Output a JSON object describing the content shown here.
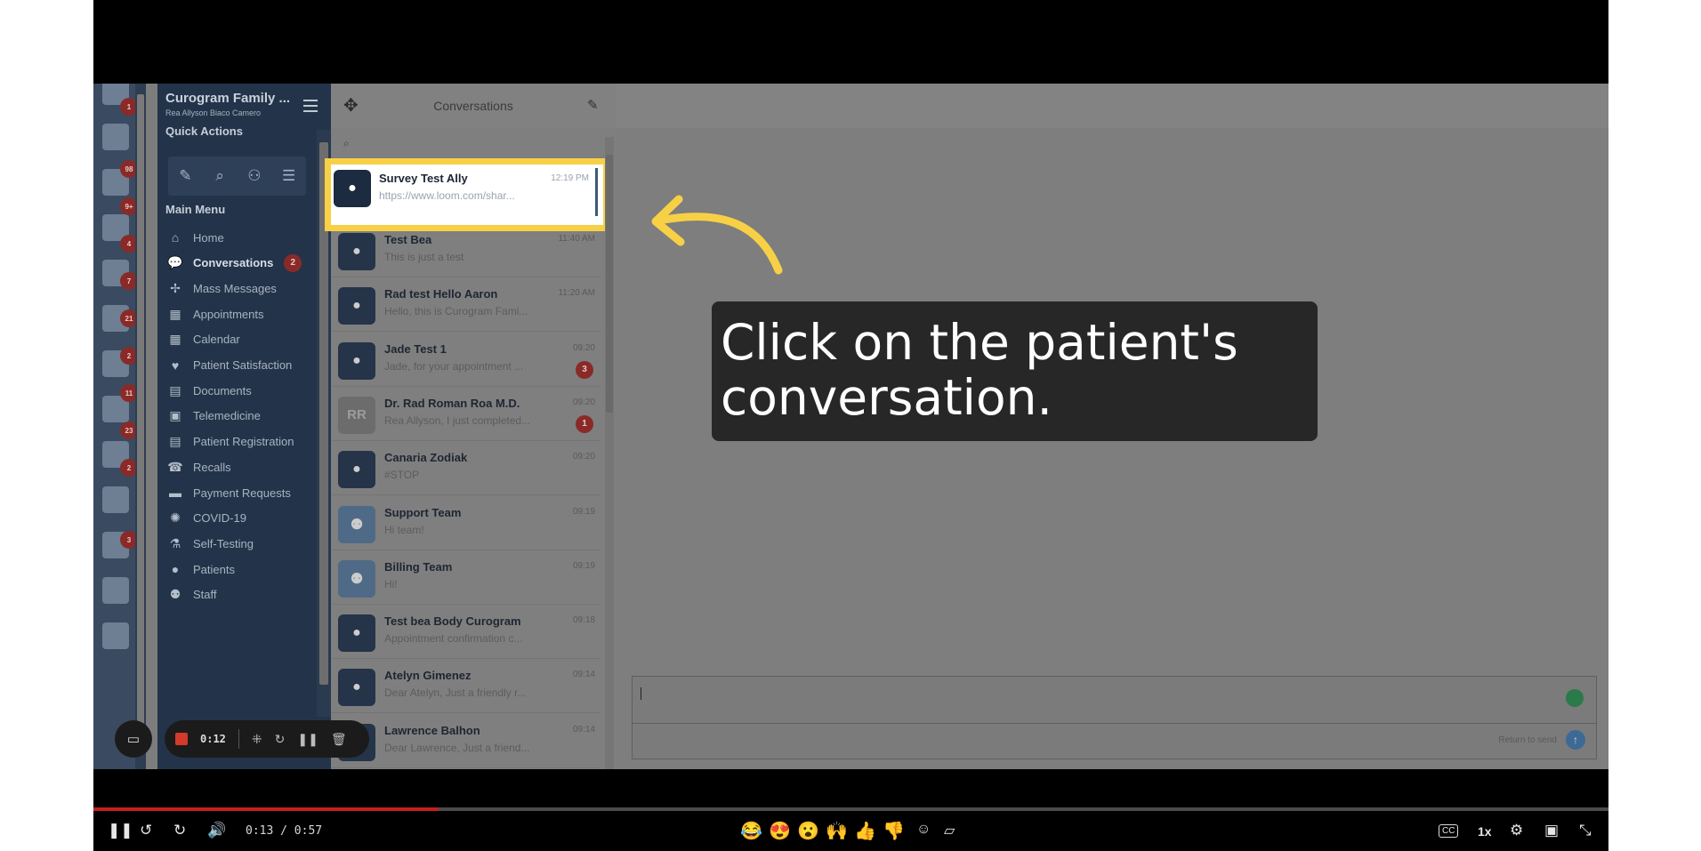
{
  "sidebar": {
    "title": "Curogram Family ...",
    "subtitle": "Rea Allyson Biaco Camero",
    "quick_actions_title": "Quick Actions",
    "main_menu_title": "Main Menu",
    "menu": [
      {
        "label": "Home",
        "icon": "home-icon"
      },
      {
        "label": "Conversations",
        "icon": "chat-icon",
        "badge": "2"
      },
      {
        "label": "Mass Messages",
        "icon": "broadcast-icon"
      },
      {
        "label": "Appointments",
        "icon": "appointments-icon"
      },
      {
        "label": "Calendar",
        "icon": "calendar-icon"
      },
      {
        "label": "Patient Satisfaction",
        "icon": "heart-icon"
      },
      {
        "label": "Documents",
        "icon": "documents-icon"
      },
      {
        "label": "Telemedicine",
        "icon": "telemedicine-icon"
      },
      {
        "label": "Patient Registration",
        "icon": "registration-icon"
      },
      {
        "label": "Recalls",
        "icon": "phone-recall-icon"
      },
      {
        "label": "Payment Requests",
        "icon": "card-icon"
      },
      {
        "label": "COVID-19",
        "icon": "virus-icon"
      },
      {
        "label": "Self-Testing",
        "icon": "flask-icon"
      },
      {
        "label": "Patients",
        "icon": "person-icon"
      },
      {
        "label": "Staff",
        "icon": "group-icon"
      }
    ]
  },
  "app_strip": {
    "badges": [
      "1",
      "98",
      "9+",
      "4",
      "7",
      "21",
      "2",
      "11",
      "23",
      "2",
      "3"
    ]
  },
  "conversations": {
    "title": "Conversations",
    "items": [
      {
        "name": "Survey Test Ally",
        "preview": "https://www.loom.com/shar...",
        "time": "12:19 PM",
        "avatar": "person"
      },
      {
        "name": "Test Bea",
        "preview": "This is just a test",
        "time": "11:40 AM",
        "avatar": "person"
      },
      {
        "name": "Rad test Hello Aaron",
        "preview": "Hello, this is Curogram Fami...",
        "time": "11:20 AM",
        "avatar": "person"
      },
      {
        "name": "Jade Test 1",
        "preview": "Jade, for your appointment ...",
        "time": "09:20",
        "avatar": "person",
        "unread": "3"
      },
      {
        "name": "Dr. Rad Roman Roa M.D.",
        "preview": "Rea Allyson, I just completed...",
        "time": "09:20",
        "avatar": "RR",
        "unread": "1"
      },
      {
        "name": "Canaria Zodiak",
        "preview": "#STOP",
        "time": "09:20",
        "avatar": "person"
      },
      {
        "name": "Support Team",
        "preview": "Hi team!",
        "time": "09:19",
        "avatar": "group"
      },
      {
        "name": "Billing Team",
        "preview": "Hi!",
        "time": "09:19",
        "avatar": "group"
      },
      {
        "name": "Test bea Body Curogram",
        "preview": "Appointment confirmation c...",
        "time": "09:18",
        "avatar": "person"
      },
      {
        "name": "Atelyn Gimenez",
        "preview": "Dear Atelyn, Just a friendly r...",
        "time": "09:14",
        "avatar": "person"
      },
      {
        "name": "Lawrence Balhon",
        "preview": "Dear Lawrence, Just a friend...",
        "time": "09:14",
        "avatar": "person"
      }
    ]
  },
  "composer": {
    "send_hint": "Return to send"
  },
  "annotation": {
    "line1": "Click on the patient's",
    "line2": "conversation.",
    "highlight_color": "#f7d046"
  },
  "recorder": {
    "time": "0:12"
  },
  "player": {
    "current": "0:13",
    "separator": "/",
    "duration": "0:57",
    "progress": 0.228,
    "speed": "1x",
    "cc": "CC",
    "reactions": [
      "😂",
      "😍",
      "😮",
      "🙌",
      "👍",
      "👎"
    ]
  },
  "colors": {
    "sidebar": "#23344a",
    "badge": "#8a2a28",
    "progress": "#c51f1f",
    "tooltip_bg": "#272727"
  }
}
